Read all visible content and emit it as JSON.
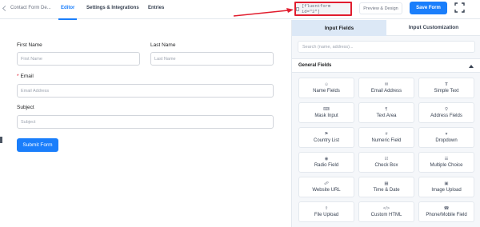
{
  "topbar": {
    "breadcrumb": "Contact Form De...",
    "tabs": [
      {
        "label": "Editor",
        "active": true
      },
      {
        "label": "Settings & Integrations",
        "active": false
      },
      {
        "label": "Entries",
        "active": false
      }
    ],
    "shortcode": "[fluentform id=\"2\"]",
    "preview_label": "Preview & Design",
    "save_label": "Save Form"
  },
  "form": {
    "first_name": {
      "label": "First Name",
      "placeholder": "First Name"
    },
    "last_name": {
      "label": "Last Name",
      "placeholder": "Last Name"
    },
    "email": {
      "label": "Email",
      "placeholder": "Email Address",
      "required_mark": "*"
    },
    "subject": {
      "label": "Subject",
      "placeholder": "Subject"
    },
    "submit_label": "Submit Form"
  },
  "panel": {
    "tabs": [
      {
        "label": "Input Fields",
        "active": true
      },
      {
        "label": "Input Customization",
        "active": false
      }
    ],
    "search_placeholder": "Search (name, address)...",
    "section_title": "General Fields",
    "fields": [
      {
        "label": "Name Fields",
        "icon": "person-icon"
      },
      {
        "label": "Email Address",
        "icon": "envelope-icon"
      },
      {
        "label": "Simple Text",
        "icon": "text-icon"
      },
      {
        "label": "Mask Input",
        "icon": "keyboard-icon"
      },
      {
        "label": "Text Area",
        "icon": "paragraph-icon"
      },
      {
        "label": "Address Fields",
        "icon": "map-pin-icon"
      },
      {
        "label": "Country List",
        "icon": "flag-icon"
      },
      {
        "label": "Numeric Field",
        "icon": "hash-icon"
      },
      {
        "label": "Dropdown",
        "icon": "dropdown-icon"
      },
      {
        "label": "Radio Field",
        "icon": "radio-icon"
      },
      {
        "label": "Check Box",
        "icon": "checkbox-icon"
      },
      {
        "label": "Multiple Choice",
        "icon": "list-icon"
      },
      {
        "label": "Website URL",
        "icon": "link-icon"
      },
      {
        "label": "Time & Date",
        "icon": "calendar-icon"
      },
      {
        "label": "Image Upload",
        "icon": "image-icon"
      },
      {
        "label": "File Upload",
        "icon": "upload-icon"
      },
      {
        "label": "Custom HTML",
        "icon": "code-icon"
      },
      {
        "label": "Phone/Mobile Field",
        "icon": "phone-icon"
      }
    ]
  },
  "colors": {
    "accent": "#1a7efb",
    "highlight": "#e11d2e"
  }
}
